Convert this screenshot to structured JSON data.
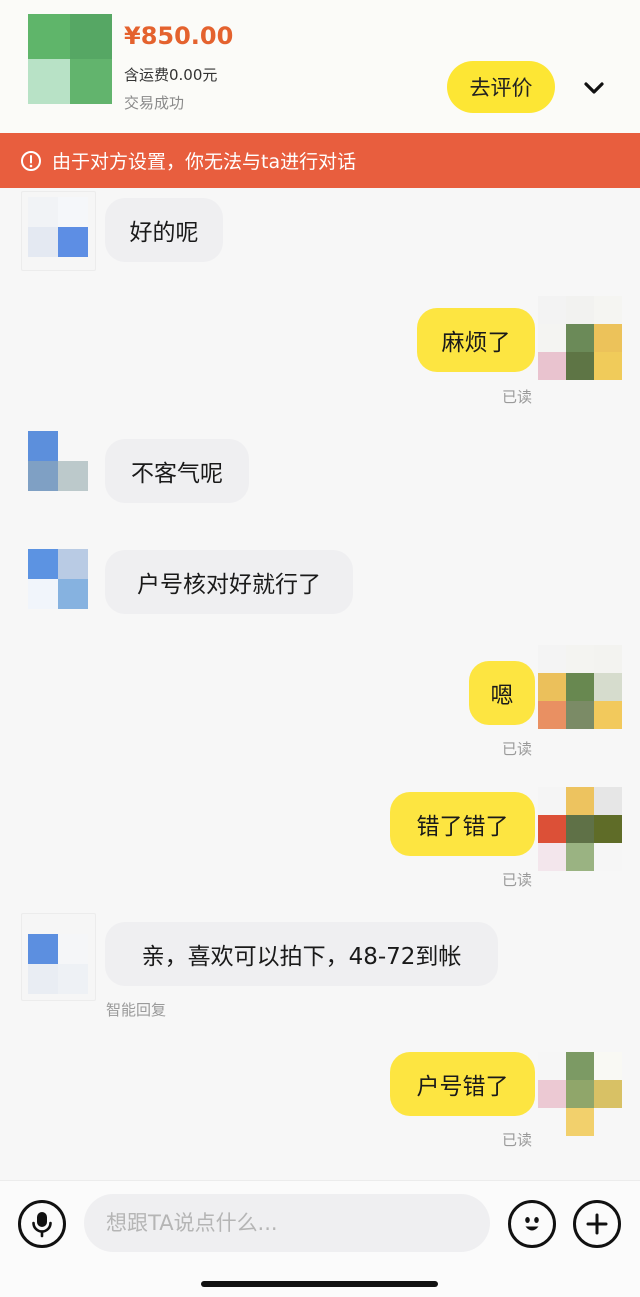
{
  "order": {
    "price": "¥850.00",
    "shipping": "含运费0.00元",
    "status": "交易成功",
    "review_label": "去评价"
  },
  "notice": {
    "text": "由于对方设置，你无法与ta进行对话"
  },
  "messages": [
    {
      "side": "in",
      "text": "好的呢"
    },
    {
      "side": "out",
      "text": "麻烦了",
      "read": "已读"
    },
    {
      "side": "in",
      "text": "不客气呢"
    },
    {
      "side": "in",
      "text": "户号核对好就行了"
    },
    {
      "side": "out",
      "text": "嗯",
      "read": "已读"
    },
    {
      "side": "out",
      "text": "错了错了",
      "read": "已读"
    },
    {
      "side": "in",
      "text": "亲，喜欢可以拍下，48-72到帐",
      "note": "智能回复"
    },
    {
      "side": "out",
      "text": "户号错了",
      "read": "已读"
    }
  ],
  "composer": {
    "placeholder": "想跟TA说点什么..."
  },
  "colors": {
    "accent_yellow": "#fde541",
    "price_orange": "#e4622e",
    "warning_red": "#e85e3e"
  },
  "icons": [
    "alert-circle-icon",
    "chevron-down-icon",
    "microphone-icon",
    "emoji-icon",
    "plus-icon"
  ]
}
